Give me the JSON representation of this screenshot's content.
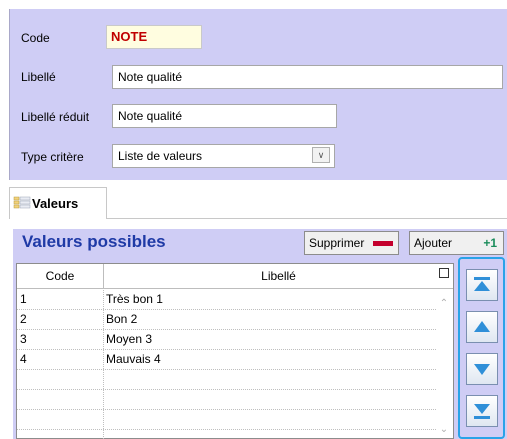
{
  "form": {
    "code_label": "Code",
    "code_value": "NOTE",
    "libelle_label": "Libellé",
    "libelle_value": "Note qualité",
    "libelle_reduit_label": "Libellé réduit",
    "libelle_reduit_value": "Note qualité",
    "type_critere_label": "Type critère",
    "type_critere_value": "Liste de valeurs"
  },
  "tab": {
    "label": "Valeurs"
  },
  "values": {
    "title": "Valeurs possibles",
    "delete_label": "Supprimer",
    "add_label": "Ajouter",
    "add_glyph": "+1",
    "columns": [
      "Code",
      "Libellé"
    ],
    "rows": [
      {
        "code": "1",
        "libelle": "Très bon 1"
      },
      {
        "code": "2",
        "libelle": "Bon 2"
      },
      {
        "code": "3",
        "libelle": "Moyen 3"
      },
      {
        "code": "4",
        "libelle": "Mauvais 4"
      }
    ]
  },
  "colors": {
    "panel": "#cfcdf5",
    "title_blue": "#1f3aa6",
    "code_red": "#c00000",
    "nav_border": "#29a3e8"
  },
  "icons": {
    "combo": "chevron-down-icon",
    "tab": "grid-list-icon",
    "delete": "minus-bar-icon",
    "add": "plus-one-icon",
    "nav": [
      "move-top-icon",
      "move-up-icon",
      "move-down-icon",
      "move-bottom-icon"
    ]
  }
}
